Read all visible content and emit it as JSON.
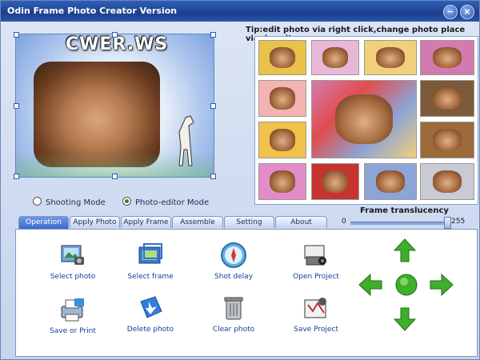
{
  "window": {
    "title": "Odin Frame Photo Creator Version",
    "minimize_glyph": "−",
    "close_glyph": "×"
  },
  "preview": {
    "logo_text": "CWER.WS"
  },
  "modes": {
    "shooting_label": "Shooting Mode",
    "editor_label": "Photo-editor Mode",
    "selected": "Photo-editor Mode"
  },
  "gallery": {
    "tip": "Tip:edit photo via right click,change photo place via drag it",
    "frame_colors": [
      "#e8c24a",
      "#e9b7d8",
      "#f0d07a",
      "#d37bb0",
      "#f4b3b3",
      "#7c5a3a",
      "#f2c14a",
      "#9b6b3c",
      "#e48cc9",
      "#c7342f",
      "#8da4d6",
      "#c9cbd4",
      "#e14d4d",
      "#6aa0d8"
    ]
  },
  "translucency": {
    "label": "Frame translucency",
    "min": "0",
    "max": "255",
    "value": 255
  },
  "tabs": [
    {
      "label": "Operation",
      "active": true
    },
    {
      "label": "Apply Photo",
      "active": false
    },
    {
      "label": "Apply Frame",
      "active": false
    },
    {
      "label": "Assemble photo",
      "active": false
    },
    {
      "label": "Setting",
      "active": false
    },
    {
      "label": "About",
      "active": false
    }
  ],
  "actions": {
    "select_photo": "Select photo",
    "select_frame": "Select frame",
    "shot_delay": "Shot delay",
    "open_project": "Open Project",
    "save_or_print": "Save or Print",
    "delete_photo": "Delete photo",
    "clear_photo": "Clear photo",
    "save_project": "Save Project"
  },
  "navigator": {
    "color": "#3fae2a"
  }
}
